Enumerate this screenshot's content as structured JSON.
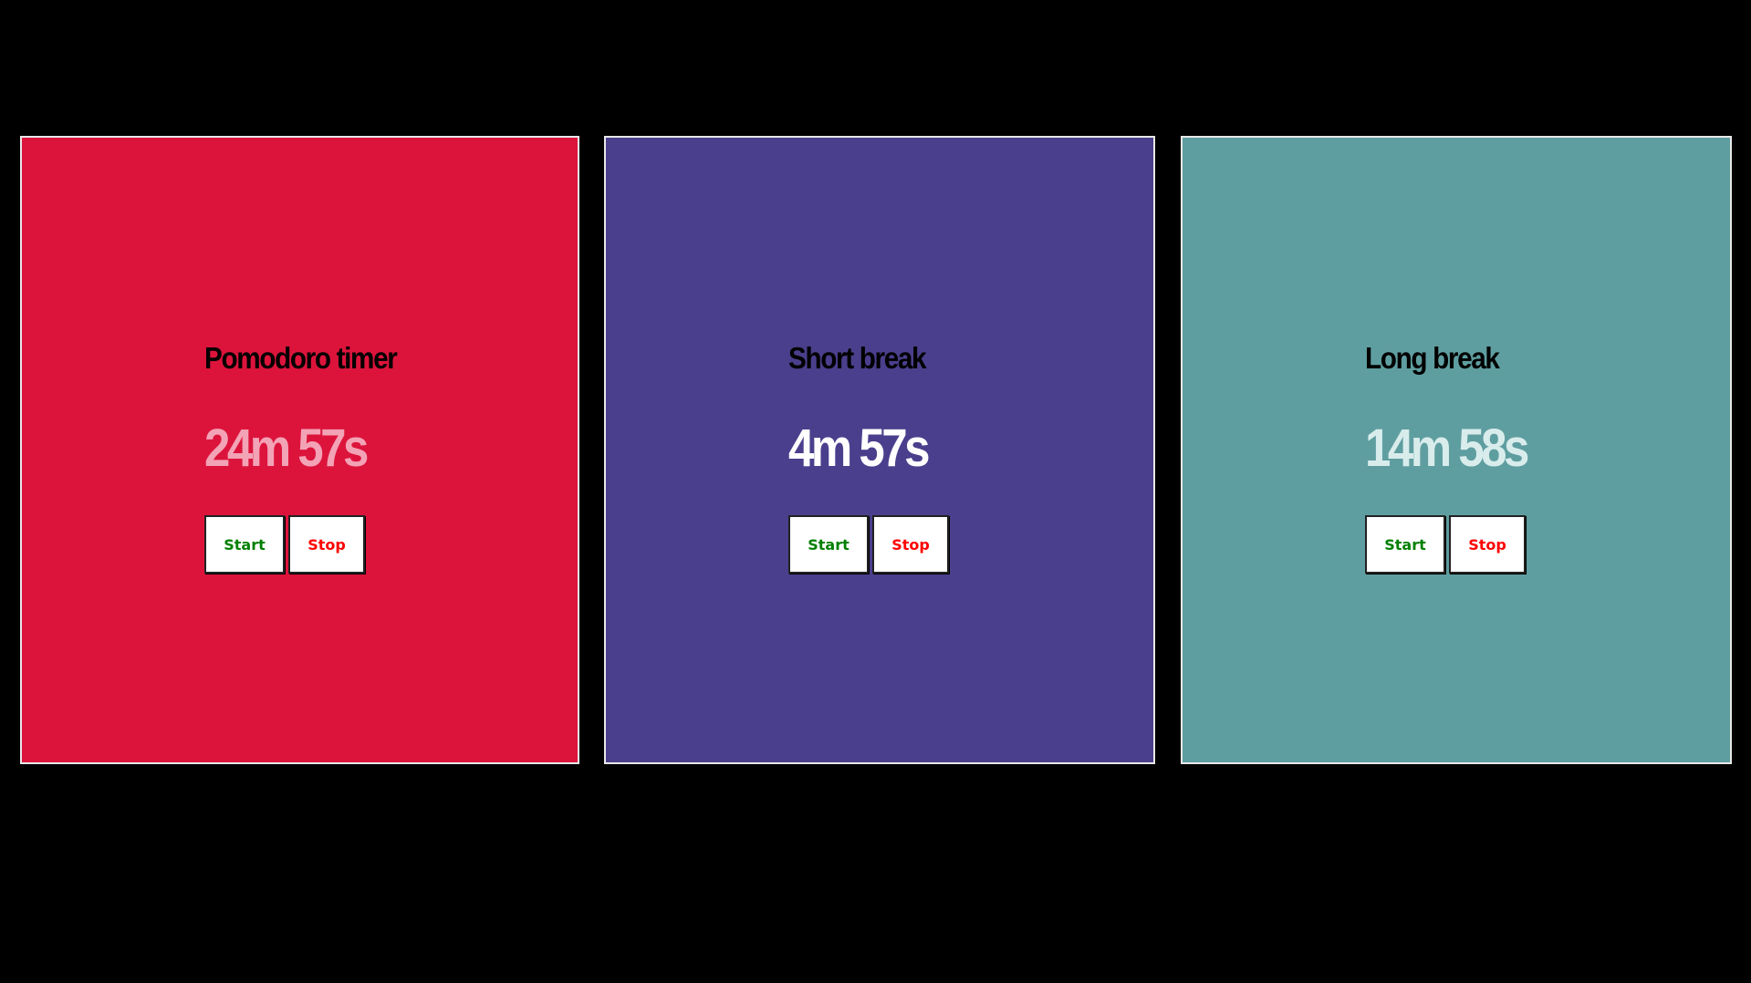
{
  "timers": [
    {
      "title": "Pomodoro timer",
      "time": "24m 57s",
      "background": "#dc143c",
      "time_color": "#f3a3b6",
      "start_label": "Start",
      "stop_label": "Stop"
    },
    {
      "title": "Short break",
      "time": "4m 57s",
      "background": "#4a3f8c",
      "time_color": "#ffffff",
      "start_label": "Start",
      "stop_label": "Stop"
    },
    {
      "title": "Long break",
      "time": "14m 58s",
      "background": "#5f9ea0",
      "time_color": "#d9ecec",
      "start_label": "Start",
      "stop_label": "Stop"
    }
  ],
  "colors": {
    "start_text": "#008000",
    "stop_text": "#ff0000",
    "button_bg": "#ffffff",
    "panel_border": "#e8e8e8"
  }
}
